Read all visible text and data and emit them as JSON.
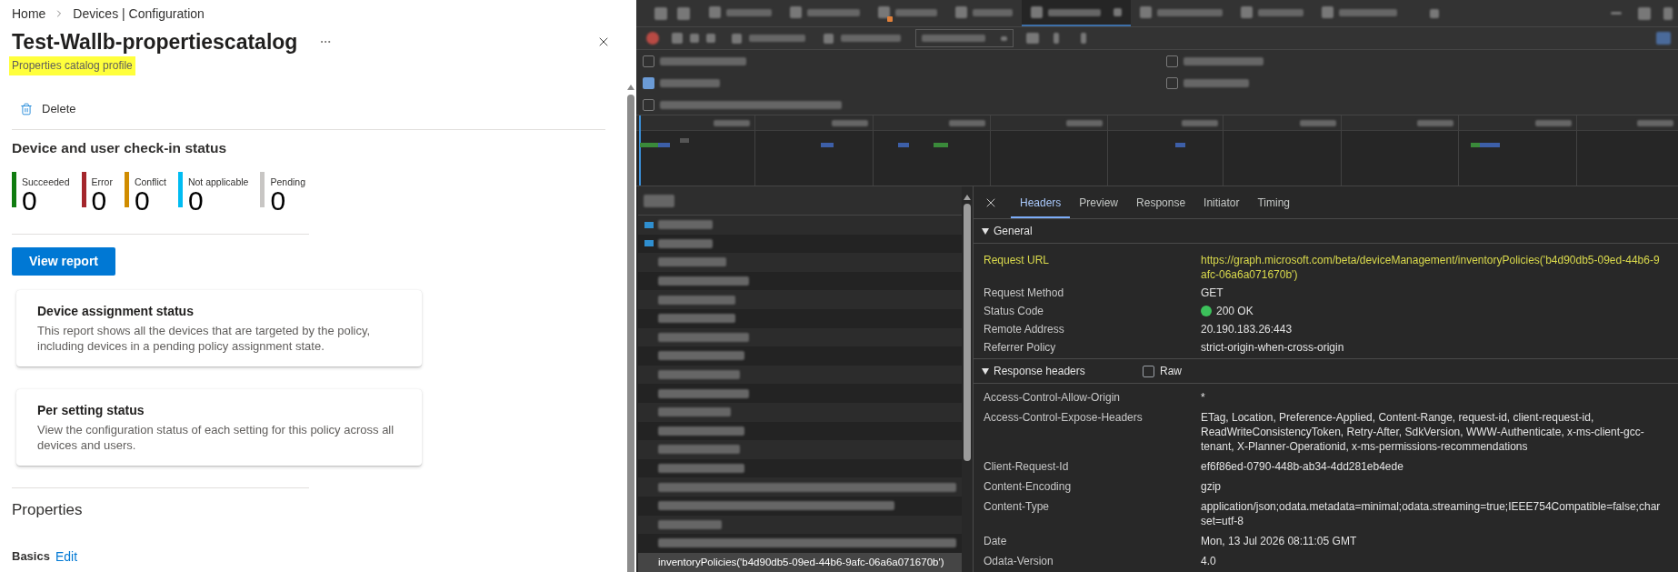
{
  "breadcrumb": [
    {
      "label": "Home"
    },
    {
      "label": "Devices | Configuration"
    }
  ],
  "title": "Test-Wallb-propertiescatalog",
  "subtitle": {
    "text": "Properties catalog profile",
    "highlighted": true
  },
  "toolbar": [
    {
      "label": "Delete"
    }
  ],
  "checkin_status": {
    "heading": "Device and user check-in status",
    "tiles": [
      {
        "label": "Succeeded",
        "value": "0",
        "color": "#107c10"
      },
      {
        "label": "Error",
        "value": "0",
        "color": "#a4262c"
      },
      {
        "label": "Conflict",
        "value": "0",
        "color": "#d08c00"
      },
      {
        "label": "Not applicable",
        "value": "0",
        "color": "#00bcf2"
      },
      {
        "label": "Pending",
        "value": "0",
        "color": "#c8c6c4"
      }
    ]
  },
  "view_report_button": "View report",
  "report_cards": [
    {
      "title": "Device assignment status",
      "description": "This report shows all the devices that are targeted by the policy, including devices in a pending policy assignment state."
    },
    {
      "title": "Per setting status",
      "description": "View the configuration status of each setting for this policy across all devices and users."
    }
  ],
  "properties": {
    "heading": "Properties",
    "sections": [
      {
        "label": "Basics",
        "link": "Edit"
      }
    ]
  },
  "devtools": {
    "panel_tabs": [
      {
        "selected": false
      },
      {
        "selected": false
      },
      {
        "selected": false
      },
      {
        "selected": false
      },
      {
        "selected": true
      },
      {
        "selected": false
      },
      {
        "selected": false
      },
      {
        "selected": false
      }
    ],
    "filter_checkboxes": [
      {
        "checked": false
      },
      {
        "checked": false
      },
      {
        "checked": true
      },
      {
        "checked": false
      },
      {
        "checked": false
      }
    ],
    "request_list": [
      {
        "name": "inventoryPolicies('b4d90db5-09ed-44b6-9afc-06a6a071670b')",
        "selected": true
      }
    ],
    "detail_tabs": [
      {
        "label": "Headers",
        "selected": true
      },
      {
        "label": "Preview",
        "selected": false
      },
      {
        "label": "Response",
        "selected": false
      },
      {
        "label": "Initiator",
        "selected": false
      },
      {
        "label": "Timing",
        "selected": false
      }
    ],
    "sections": [
      {
        "title": "General",
        "expanded": true,
        "rows": [
          {
            "name": "Request URL",
            "value": "https://graph.microsoft.com/beta/deviceManagement/inventoryPolicies('b4d90db5-09ed-44b6-9afc-06a6a071670b')",
            "kind": "text",
            "highlighted": true
          },
          {
            "name": "Request Method",
            "value": "GET",
            "kind": "text",
            "highlighted": false
          },
          {
            "name": "Status Code",
            "value": "200 OK",
            "kind": "status",
            "highlighted": false
          },
          {
            "name": "Remote Address",
            "value": "20.190.183.26:443",
            "kind": "text",
            "highlighted": false
          },
          {
            "name": "Referrer Policy",
            "value": "strict-origin-when-cross-origin",
            "kind": "text",
            "highlighted": false
          }
        ]
      },
      {
        "title": "Response headers",
        "expanded": true,
        "raw_toggle": {
          "label": "Raw",
          "checked": false
        },
        "rows": [
          {
            "name": "Access-Control-Allow-Origin",
            "value": "*",
            "kind": "text",
            "highlighted": false
          },
          {
            "name": "Access-Control-Expose-Headers",
            "value": "ETag, Location, Preference-Applied, Content-Range, request-id, client-request-id, ReadWriteConsistencyToken, Retry-After, SdkVersion, WWW-Authenticate, x-ms-client-gcc-tenant, X-Planner-Operationid, x-ms-permissions-recommendations",
            "kind": "text",
            "highlighted": false
          },
          {
            "name": "Client-Request-Id",
            "value": "ef6f86ed-0790-448b-ab34-4dd281eb4ede",
            "kind": "text",
            "highlighted": false
          },
          {
            "name": "Content-Encoding",
            "value": "gzip",
            "kind": "text",
            "highlighted": false
          },
          {
            "name": "Content-Type",
            "value": "application/json;odata.metadata=minimal;odata.streaming=true;IEEE754Compatible=false;charset=utf-8",
            "kind": "text",
            "highlighted": false
          },
          {
            "name": "Date",
            "value": "Mon, 13 Jul 2026 08:11:05 GMT",
            "kind": "text",
            "highlighted": false
          },
          {
            "name": "Odata-Version",
            "value": "4.0",
            "kind": "text",
            "highlighted": false
          }
        ]
      }
    ]
  }
}
